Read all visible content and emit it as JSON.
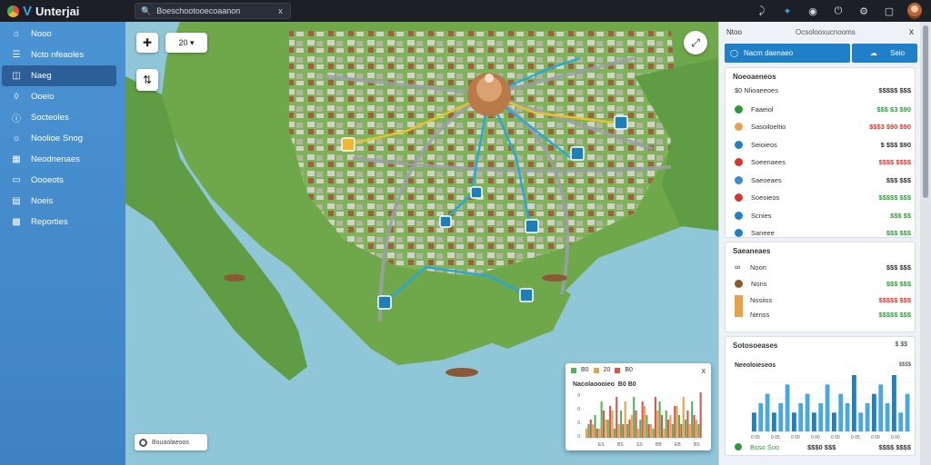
{
  "app": {
    "title": "Unterjai"
  },
  "search": {
    "value": "Boeschootooecoaanon",
    "clear": "x"
  },
  "topbar": {
    "icons": [
      "pin-icon",
      "share-icon",
      "globe-icon",
      "power-icon",
      "settings-icon",
      "window-icon"
    ]
  },
  "sidebar": {
    "items": [
      {
        "label": "Nooo",
        "icon": "home-icon"
      },
      {
        "label": "Ncto nfeaoles",
        "icon": "list-icon"
      },
      {
        "label": "Naeg",
        "icon": "map-icon",
        "active": true
      },
      {
        "label": "Ooeio",
        "icon": "drop-icon"
      },
      {
        "label": "Socteoles",
        "icon": "info-icon"
      },
      {
        "label": "Noolioe Snog",
        "icon": "chat-icon"
      },
      {
        "label": "Neodnenaes",
        "icon": "grid-icon"
      },
      {
        "label": "Oooeots",
        "icon": "box-icon"
      },
      {
        "label": "Noeis",
        "icon": "doc-icon"
      },
      {
        "label": "Reporties",
        "icon": "report-icon"
      }
    ]
  },
  "map": {
    "zoom_label": "20",
    "scale_text": "Bouaolaeoos",
    "chart": {
      "legend": [
        "B0",
        "20",
        "B0"
      ],
      "title": "Nacolaoooieo",
      "title_value": "B0 B0",
      "close": "x",
      "xlabels": [
        "ES",
        "BS",
        "SS",
        "BB",
        "EB",
        "BS"
      ],
      "ylabels": [
        "0",
        "0",
        "0",
        "0"
      ],
      "series": [
        {
          "color": "#e8a14a",
          "values": [
            2,
            3,
            2,
            4,
            6,
            3,
            8,
            5,
            2,
            7,
            3,
            6,
            2,
            5,
            7,
            9,
            3,
            4
          ]
        },
        {
          "color": "#4fb35a",
          "values": [
            3,
            5,
            8,
            4,
            2,
            6,
            3,
            9,
            4,
            5,
            2,
            8,
            6,
            3,
            5,
            4,
            8,
            3
          ]
        },
        {
          "color": "#d9534f",
          "values": [
            4,
            2,
            6,
            7,
            9,
            3,
            4,
            6,
            8,
            3,
            9,
            5,
            4,
            7,
            3,
            6,
            5,
            10
          ]
        }
      ]
    }
  },
  "panel": {
    "header": {
      "left": "Ntoo",
      "center": "Ocsolooxucnooms",
      "close": "x"
    },
    "tabs": {
      "main": "Nacm daenaeo",
      "side": "Seio"
    },
    "card1": {
      "title": "Noeoaeneos",
      "sub_label": "$0 Nlioaeeoes",
      "sub_value": "$$$$$ $$$",
      "rows": [
        {
          "label": "Faaeiol",
          "value": "$$$ $3 $90",
          "color": "#2f9b3a",
          "vclass": "green"
        },
        {
          "label": "Sasoiloeltio",
          "value": "$$$3 $90 $90",
          "color": "#e8a14a",
          "vclass": "red"
        },
        {
          "label": "Seioieos",
          "value": "$ $$$ $90",
          "color": "#1f7fc9",
          "vclass": "dark"
        },
        {
          "label": "Soeenaees",
          "value": "$$$$ $$$$",
          "color": "#d6372e",
          "vclass": "red"
        },
        {
          "label": "Saeoeaes",
          "value": "$$$ $$$",
          "color": "#3a8bd0",
          "vclass": "dark"
        },
        {
          "label": "Soeoieos",
          "value": "$$$$$ $$$",
          "color": "#d6372e",
          "vclass": "green"
        },
        {
          "label": "Scnies",
          "value": "$$$ $$",
          "color": "#1f7fc9",
          "vclass": "green"
        },
        {
          "label": "Saneee",
          "value": "$$$ $$$",
          "color": "#1f7fc9",
          "vclass": "green"
        }
      ]
    },
    "card2": {
      "title": "Saeaneaes",
      "rows": [
        {
          "label": "Noon",
          "value": "$$$ $$$",
          "vclass": "dark"
        },
        {
          "label": "Nons",
          "value": "$$$ $$$",
          "vclass": "green"
        },
        {
          "label": "Nosiiss",
          "value": "$$$$$ $$$",
          "vclass": "red"
        },
        {
          "label": "Nenss",
          "value": "$$$$$ $$$",
          "vclass": "green"
        }
      ]
    },
    "card3": {
      "title": "Sotosoeases",
      "badge": "$ $$",
      "chart_title": "Neeoloieseos",
      "chart_title_value": "$$$$",
      "values": [
        2,
        3,
        4,
        2,
        3,
        5,
        2,
        3,
        4,
        2,
        3,
        5,
        2,
        4,
        3,
        6,
        2,
        3,
        4,
        5,
        3,
        6,
        2,
        4
      ],
      "xlabels": [
        "0 05",
        "0 05",
        "0 00",
        "0 00",
        "0 00",
        "0 05",
        "0 00",
        "0 00"
      ],
      "footer_left": "Bsso Soo",
      "footer_mid": "$$$0 $$$",
      "footer_right": "$$$$ $$$$"
    }
  },
  "colors": {
    "accent": "#1f7fc9",
    "sidebar": "#4a93d2",
    "positive": "#2f9b3a",
    "negative": "#d6372e"
  }
}
